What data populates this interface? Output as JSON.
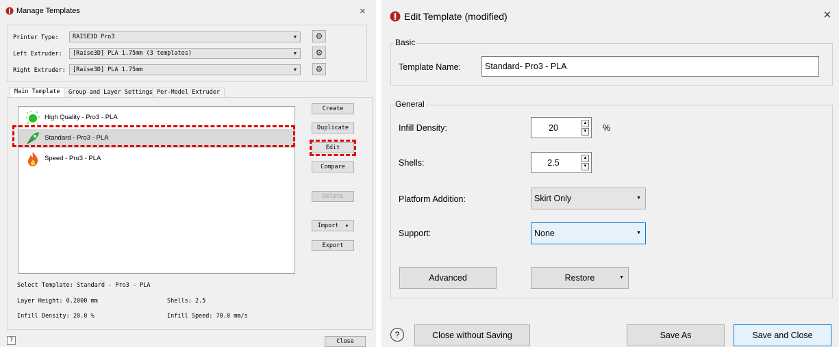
{
  "left_dialog": {
    "title": "Manage Templates",
    "close_glyph": "×",
    "printer_type_label": "Printer Type:",
    "printer_type_value": "RAISE3D Pro3",
    "left_extruder_label": "Left Extruder:",
    "left_extruder_value": "[Raise3D] PLA 1.75mm (3 templates)",
    "right_extruder_label": "Right Extruder:",
    "right_extruder_value": "[Raise3D] PLA 1.75mm",
    "tabs": [
      "Main Template",
      "Group and Layer Settings",
      "Per-Model Extruder"
    ],
    "templates": [
      {
        "name": "High Quality - Pro3 - PLA",
        "icon": "green-dots-icon"
      },
      {
        "name": "Standard - Pro3 - PLA",
        "icon": "rocket-icon"
      },
      {
        "name": "Speed - Pro3 - PLA",
        "icon": "flame-icon"
      }
    ],
    "buttons": {
      "create": "Create",
      "duplicate": "Duplicate",
      "edit": "Edit",
      "compare": "Compare",
      "delete": "Delete",
      "import": "Import",
      "export": "Export",
      "close": "Close"
    },
    "selected_template": "Select Template: Standard - Pro3 - PLA",
    "layer_height": "Layer Height: 0.2000 mm",
    "shells": "Shells: 2.5",
    "infill_density": "Infill Density: 20.0 %",
    "infill_speed": "Infill Speed: 70.0 mm/s",
    "help_glyph": "?"
  },
  "right_dialog": {
    "title": "Edit Template (modified)",
    "close_glyph": "×",
    "basic_group": "Basic",
    "template_name_label": "Template Name:",
    "template_name_value": "Standard- Pro3 - PLA",
    "general_group": "General",
    "infill_density_label": "Infill Density:",
    "infill_density_value": "20",
    "infill_unit": "%",
    "shells_label": "Shells:",
    "shells_value": "2.5",
    "platform_label": "Platform Addition:",
    "platform_value": "Skirt Only",
    "support_label": "Support:",
    "support_value": "None",
    "advanced": "Advanced",
    "restore": "Restore",
    "help_glyph": "?",
    "close_without_saving": "Close without Saving",
    "save_as": "Save As",
    "save_and_close": "Save and Close"
  },
  "colors": {
    "highlight_dash": "#e00000",
    "brand_icon": "#b22222",
    "primary_border": "#0078d7"
  }
}
